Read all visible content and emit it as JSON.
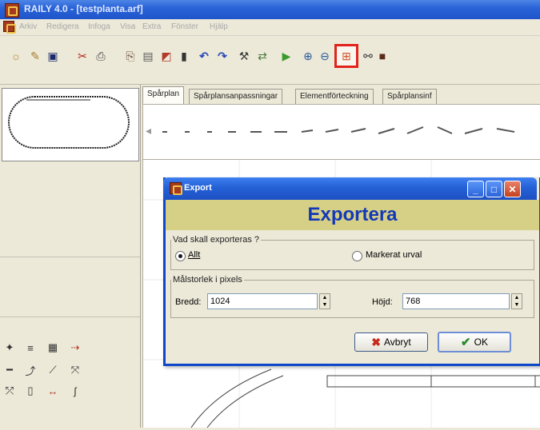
{
  "window": {
    "title": "RAILY 4.0 - [testplanta.arf]"
  },
  "menu": [
    "Arkiv",
    "Redigera",
    "Infoga",
    "Visa",
    "Extra",
    "Fönster",
    "Hjälp"
  ],
  "toolbar": {
    "icons": [
      "new-icon",
      "open-icon",
      "save-icon",
      "cut-icon",
      "print-icon",
      "copy-icon",
      "paste-icon",
      "select-icon",
      "delete-icon",
      "undo-icon",
      "redo-icon",
      "tool-icon",
      "insert-icon",
      "play-icon",
      "zoom-in-icon",
      "zoom-out-icon",
      "export-icon",
      "track-icon",
      "color-icon"
    ],
    "glyphs": [
      "☼",
      "✎",
      "💾",
      "✂",
      "🖶",
      "⎘",
      "📋",
      "⬚",
      "🗑",
      "↶",
      "↷",
      "⚙",
      "⇄",
      "▶",
      "🔍",
      "🔍",
      "⊞",
      "⚯",
      "■"
    ],
    "highlighted": "export-icon"
  },
  "tabs": [
    {
      "label": "Spårplan",
      "active": true
    },
    {
      "label": "Spårplansanpassningar",
      "active": false
    },
    {
      "label": "Elementförteckning",
      "active": false
    },
    {
      "label": "Spårplansinf",
      "active": false
    }
  ],
  "dialog": {
    "title": "Export",
    "header": "Exportera",
    "group1": {
      "legend": "Vad skall exporteras ?",
      "option_all": "Allt",
      "option_selection": "Markerat urval",
      "selected": "Allt"
    },
    "group2": {
      "legend": "Målstorlek i pixels",
      "width_label": "Bredd:",
      "width_value": "1024",
      "height_label": "Höjd:",
      "height_value": "768"
    },
    "cancel_label": "Avbryt",
    "ok_label": "OK"
  },
  "colors": {
    "accent_red": "#e2231a",
    "dialog_header": "#d6cf86",
    "header_text": "#1238b8"
  }
}
